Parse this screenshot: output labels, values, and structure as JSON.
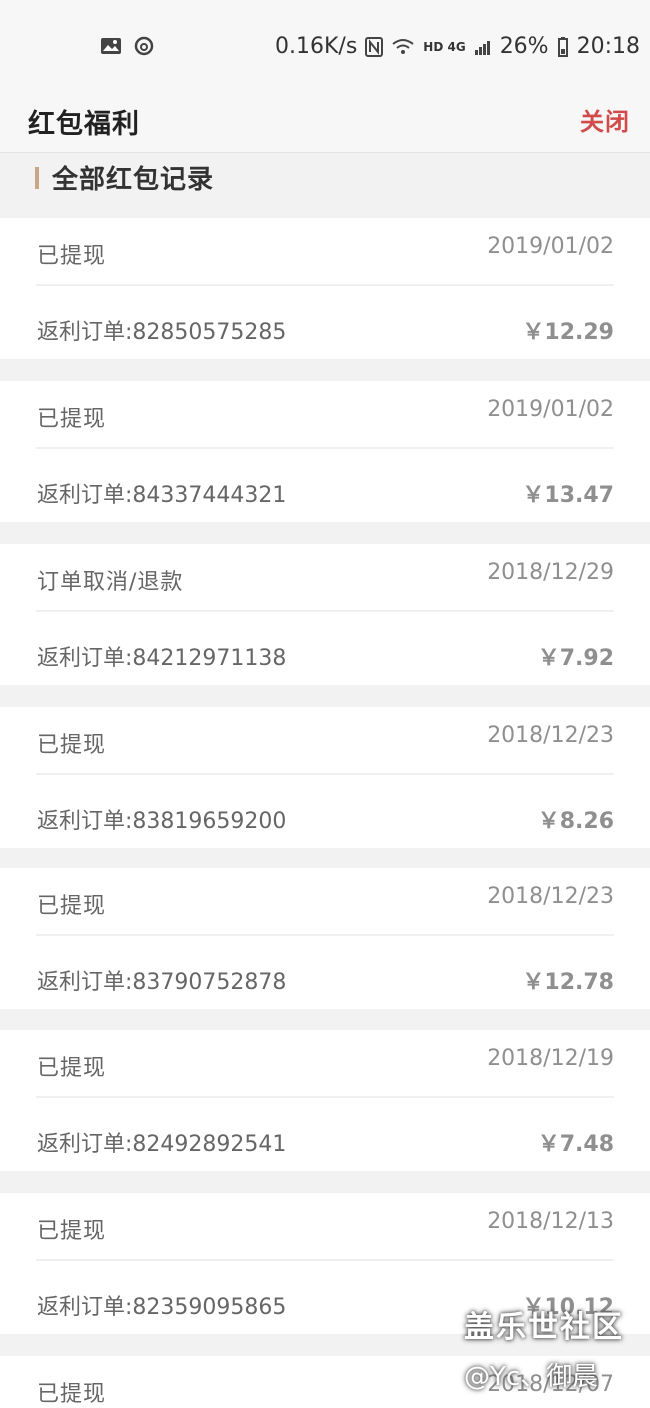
{
  "status_bar": {
    "speed": "0.16K/s",
    "signal_text": "HD 4G",
    "battery": "26%",
    "time": "20:18"
  },
  "header": {
    "title": "红包福利",
    "close_label": "关闭"
  },
  "section": {
    "title": "全部红包记录"
  },
  "records": [
    {
      "status": "已提现",
      "date": "2019/01/02",
      "order": "返利订单:82850575285",
      "amount": "￥12.29"
    },
    {
      "status": "已提现",
      "date": "2019/01/02",
      "order": "返利订单:84337444321",
      "amount": "￥13.47"
    },
    {
      "status": "订单取消/退款",
      "date": "2018/12/29",
      "order": "返利订单:84212971138",
      "amount": "￥7.92"
    },
    {
      "status": "已提现",
      "date": "2018/12/23",
      "order": "返利订单:83819659200",
      "amount": "￥8.26"
    },
    {
      "status": "已提现",
      "date": "2018/12/23",
      "order": "返利订单:83790752878",
      "amount": "￥12.78"
    },
    {
      "status": "已提现",
      "date": "2018/12/19",
      "order": "返利订单:82492892541",
      "amount": "￥7.48"
    },
    {
      "status": "已提现",
      "date": "2018/12/13",
      "order": "返利订单:82359095865",
      "amount": "￥10.12"
    },
    {
      "status": "已提现",
      "date": "2018/12/07",
      "order": "",
      "amount": ""
    }
  ],
  "watermark": {
    "line1": "盖乐世社区",
    "line2": "@Yc、御晨"
  }
}
